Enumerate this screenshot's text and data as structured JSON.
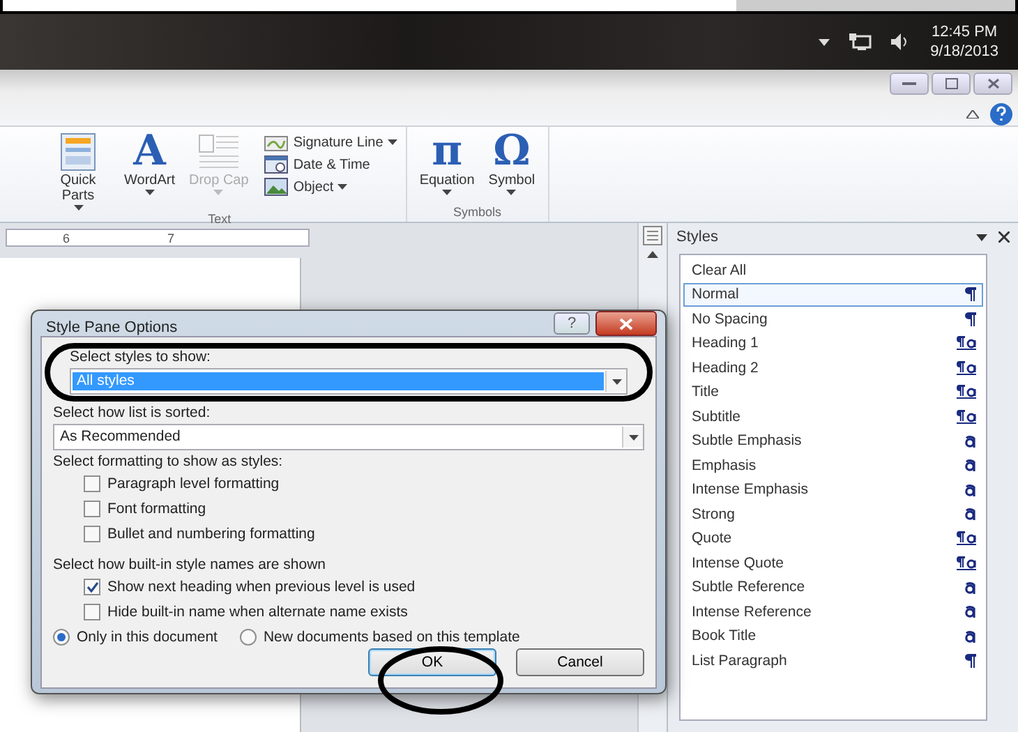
{
  "taskbar": {
    "time": "12:45 PM",
    "date": "9/18/2013"
  },
  "ribbon": {
    "groups": [
      {
        "label": "Text",
        "items": [
          {
            "kind": "large",
            "label": "Quick Parts",
            "dropdown": true,
            "disabled": false
          },
          {
            "kind": "large",
            "label": "WordArt",
            "glyph": "A",
            "dropdown": true,
            "disabled": false
          },
          {
            "kind": "large",
            "label": "Drop Cap",
            "dropdown": true,
            "disabled": true
          },
          {
            "kind": "small",
            "label": "Signature Line",
            "dropdown": true,
            "disabled": false
          },
          {
            "kind": "small",
            "label": "Date & Time",
            "dropdown": false,
            "disabled": false
          },
          {
            "kind": "small",
            "label": "Object",
            "dropdown": true,
            "disabled": false
          }
        ]
      },
      {
        "label": "Symbols",
        "items": [
          {
            "kind": "large",
            "label": "Equation",
            "glyph": "π",
            "dropdown": true,
            "disabled": false
          },
          {
            "kind": "large",
            "label": "Symbol",
            "glyph": "Ω",
            "dropdown": true,
            "disabled": false
          }
        ]
      }
    ]
  },
  "ruler": {
    "marks": [
      "6",
      "7"
    ]
  },
  "dialog": {
    "title": "Style Pane Options",
    "help": "?",
    "show_label": "Select styles to show:",
    "show_value": "All styles",
    "sort_label": "Select how list is sorted:",
    "sort_value": "As Recommended",
    "format_label": "Select formatting to show as styles:",
    "format_options": [
      {
        "label": "Paragraph level formatting",
        "checked": false
      },
      {
        "label": "Font formatting",
        "checked": false
      },
      {
        "label": "Bullet and numbering formatting",
        "checked": false
      }
    ],
    "names_label": "Select how built-in style names are shown",
    "names_options": [
      {
        "label": "Show next heading when previous level is used",
        "checked": true
      },
      {
        "label": "Hide built-in name when alternate name exists",
        "checked": false
      }
    ],
    "scope": [
      {
        "label": "Only in this document",
        "selected": true
      },
      {
        "label": "New documents based on this template",
        "selected": false
      }
    ],
    "buttons": [
      "OK",
      "Cancel"
    ]
  },
  "styles_pane": {
    "title": "Styles",
    "clear_all": "Clear All",
    "items": [
      {
        "name": "Normal",
        "kind": "paragraph",
        "selected": true
      },
      {
        "name": "No Spacing",
        "kind": "paragraph",
        "selected": false
      },
      {
        "name": "Heading 1",
        "kind": "linked",
        "selected": false
      },
      {
        "name": "Heading 2",
        "kind": "linked",
        "selected": false
      },
      {
        "name": "Title",
        "kind": "linked",
        "selected": false
      },
      {
        "name": "Subtitle",
        "kind": "linked",
        "selected": false
      },
      {
        "name": "Subtle Emphasis",
        "kind": "character",
        "selected": false
      },
      {
        "name": "Emphasis",
        "kind": "character",
        "selected": false
      },
      {
        "name": "Intense Emphasis",
        "kind": "character",
        "selected": false
      },
      {
        "name": "Strong",
        "kind": "character",
        "selected": false
      },
      {
        "name": "Quote",
        "kind": "linked",
        "selected": false
      },
      {
        "name": "Intense Quote",
        "kind": "linked",
        "selected": false
      },
      {
        "name": "Subtle Reference",
        "kind": "character",
        "selected": false
      },
      {
        "name": "Intense Reference",
        "kind": "character",
        "selected": false
      },
      {
        "name": "Book Title",
        "kind": "character",
        "selected": false
      },
      {
        "name": "List Paragraph",
        "kind": "paragraph",
        "selected": false
      }
    ]
  }
}
